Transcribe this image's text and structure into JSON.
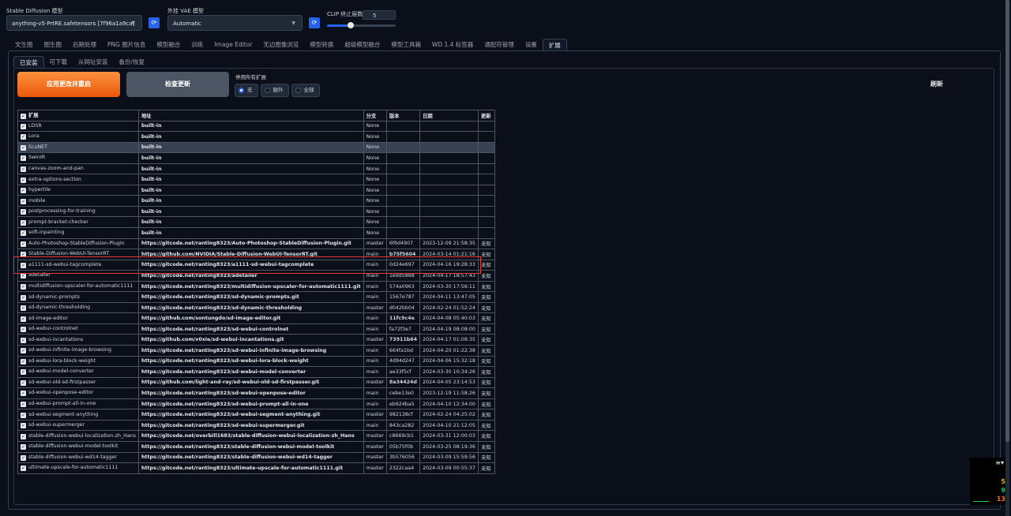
{
  "top": {
    "sd_model_label": "Stable Diffusion 模型",
    "sd_model_value": "anything-v5-PrtRE.safetensors [7f96a1a9ca]",
    "vae_label": "外挂 VAE 模型",
    "vae_value": "Automatic",
    "clip_label": "CLIP 终止层数",
    "clip_value": "5",
    "clip_slider_fraction": 0.35
  },
  "main_tabs": [
    "文生图",
    "图生图",
    "后期处理",
    "PNG 图片信息",
    "模型融合",
    "训练",
    "Image Editor",
    "无边图像浏览",
    "模型转换",
    "超级模型融合",
    "模型工具箱",
    "WD 1.4 标签器",
    "通配符管理",
    "设置",
    "扩展"
  ],
  "active_tab": 14,
  "sub_tabs": [
    "已安装",
    "可下载",
    "从网址安装",
    "备份/恢复"
  ],
  "active_sub_tab": 0,
  "buttons": {
    "apply": "应用更改并重启",
    "check": "检查更新",
    "refresh": "刷新"
  },
  "disable_all": {
    "label": "停用所有扩展",
    "options": [
      "无",
      "额外",
      "全部"
    ],
    "selected": 0
  },
  "table": {
    "headers": [
      "扩展",
      "地址",
      "分支",
      "版本",
      "日期",
      "更新"
    ],
    "rows": [
      [
        "LDSR",
        "built-in",
        "None",
        "",
        "",
        ""
      ],
      [
        "Lora",
        "built-in",
        "None",
        "",
        "",
        ""
      ],
      [
        "ScuNET",
        "built-in",
        "None",
        "",
        "",
        ""
      ],
      [
        "SwinIR",
        "built-in",
        "None",
        "",
        "",
        ""
      ],
      [
        "canvas-zoom-and-pan",
        "built-in",
        "None",
        "",
        "",
        ""
      ],
      [
        "extra-options-section",
        "built-in",
        "None",
        "",
        "",
        ""
      ],
      [
        "hypertile",
        "built-in",
        "None",
        "",
        "",
        ""
      ],
      [
        "mobile",
        "built-in",
        "None",
        "",
        "",
        ""
      ],
      [
        "postprocessing-for-training",
        "built-in",
        "None",
        "",
        "",
        ""
      ],
      [
        "prompt-bracket-checker",
        "built-in",
        "None",
        "",
        "",
        ""
      ],
      [
        "soft-inpainting",
        "built-in",
        "None",
        "",
        "",
        ""
      ],
      [
        "Auto-Photoshop-StableDiffusion-Plugin",
        "https://gitcode.net/ranting8323/Auto-Photoshop-StableDiffusion-Plugin.git",
        "master",
        "6f6d4907",
        "2023-12-09 21:58:35",
        "未知"
      ],
      [
        "Stable-Diffusion-WebUI-TensorRT",
        "https://github.com/NVIDIA/Stable-Diffusion-WebUI-TensorRT.git",
        "main",
        "b75f5604",
        "2024-03-14 01:21:16",
        "未知"
      ],
      [
        "a1111-sd-webui-tagcomplete",
        "https://gitcode.net/ranting8323/a1111-sd-webui-tagcomplete",
        "main",
        "0d24e697",
        "2024-04-16 19:28:33",
        "未知"
      ],
      [
        "adetailer",
        "https://gitcode.net/ranting8323/adetailer",
        "main",
        "1edd5888",
        "2024-04-17 18:57:43",
        "未知"
      ],
      [
        "multidiffusion-upscaler-for-automatic1111",
        "https://gitcode.net/ranting8323/multidiffusion-upscaler-for-automatic1111.git",
        "main",
        "574a0963",
        "2024-03-30 17:56:11",
        "未知"
      ],
      [
        "sd-dynamic-prompts",
        "https://gitcode.net/ranting8323/sd-dynamic-prompts.git",
        "main",
        "1567e787",
        "2024-04-11 13:47:05",
        "未知"
      ],
      [
        "sd-dynamic-thresholding",
        "https://gitcode.net/ranting8323/sd-dynamic-thresholding",
        "master",
        "d042bb04",
        "2024-02-24 01:52:24",
        "未知"
      ],
      [
        "sd-image-editor",
        "https://github.com/sontungdo/sd-image-editor.git",
        "main",
        "11fc9c4e",
        "2024-04-08 05:40:03",
        "未知"
      ],
      [
        "sd-webui-controlnet",
        "https://gitcode.net/ranting8323/sd-webui-controlnet",
        "main",
        "fa72f3e7",
        "2024-04-19 08:08:00",
        "未知"
      ],
      [
        "sd-webui-incantations",
        "https://github.com/v0xie/sd-webui-incantations.git",
        "master",
        "73911b64",
        "2024-04-17 01:09:35",
        "未知"
      ],
      [
        "sd-webui-infinite-image-browsing",
        "https://gitcode.net/ranting8323/sd-webui-infinite-image-browsing",
        "main",
        "664fa1bd",
        "2024-04-20 01:22:38",
        "未知"
      ],
      [
        "sd-webui-lora-block-weight",
        "https://gitcode.net/ranting8323/sd-webui-lora-block-weight",
        "main",
        "4d94d247",
        "2024-04-06 15:32:18",
        "未知"
      ],
      [
        "sd-webui-model-converter",
        "https://gitcode.net/ranting8323/sd-webui-model-converter",
        "main",
        "ae33f5cf",
        "2024-03-30 10:34:26",
        "未知"
      ],
      [
        "sd-webui-old-sd-firstpasser",
        "https://github.com/light-and-ray/sd-webui-old-sd-firstpasser.git",
        "master",
        "8a34424d",
        "2024-04-05 23:14:53",
        "未知"
      ],
      [
        "sd-webui-openpose-editor",
        "https://gitcode.net/ranting8323/sd-webui-openpose-editor",
        "main",
        "cebe13e0",
        "2023-12-19 11:58:26",
        "未知"
      ],
      [
        "sd-webui-prompt-all-in-one",
        "https://gitcode.net/ranting8323/sd-webui-prompt-all-in-one",
        "main",
        "eb924ba5",
        "2024-04-10 12:34:00",
        "未知"
      ],
      [
        "sd-webui-segment-anything",
        "https://gitcode.net/ranting8323/sd-webui-segment-anything.git",
        "master",
        "982138cf",
        "2024-02-24 04:25:02",
        "未知"
      ],
      [
        "sd-webui-supermerger",
        "https://gitcode.net/ranting8323/sd-webui-supermerger.git",
        "main",
        "843ca282",
        "2024-04-10 21:12:05",
        "未知"
      ],
      [
        "stable-diffusion-webui-localization-zh_Hans",
        "https://gitcode.net/overbill1683/stable-diffusion-webui-localization-zh_Hans",
        "master",
        "c8669cb1",
        "2024-03-31 12:00:03",
        "未知"
      ],
      [
        "stable-diffusion-webui-model-toolkit",
        "https://gitcode.net/ranting8323/stable-diffusion-webui-model-toolkit",
        "master",
        "05b75f0b",
        "2024-03-25 08:19:36",
        "未知"
      ],
      [
        "stable-diffusion-webui-wd14-tagger",
        "https://gitcode.net/ranting8323/stable-diffusion-webui-wd14-tagger",
        "master",
        "3b576056",
        "2024-03-09 15:59:56",
        "未知"
      ],
      [
        "ultimate-upscale-for-automatic1111",
        "https://gitcode.net/ranting8323/ultimate-upscale-for-automatic1111.git",
        "master",
        "2322caa4",
        "2024-03-09 00:55:37",
        "未知"
      ]
    ],
    "highlighted_row": 2,
    "annotated_row": 12
  },
  "colors": {
    "background": "#0b0f19",
    "apply_button": "#f97316",
    "check_button": "#4b5563",
    "accent": "#2563eb",
    "annotation": "#e53935"
  },
  "widget": {
    "l1": "5",
    "l2": "9",
    "l3": "13"
  }
}
